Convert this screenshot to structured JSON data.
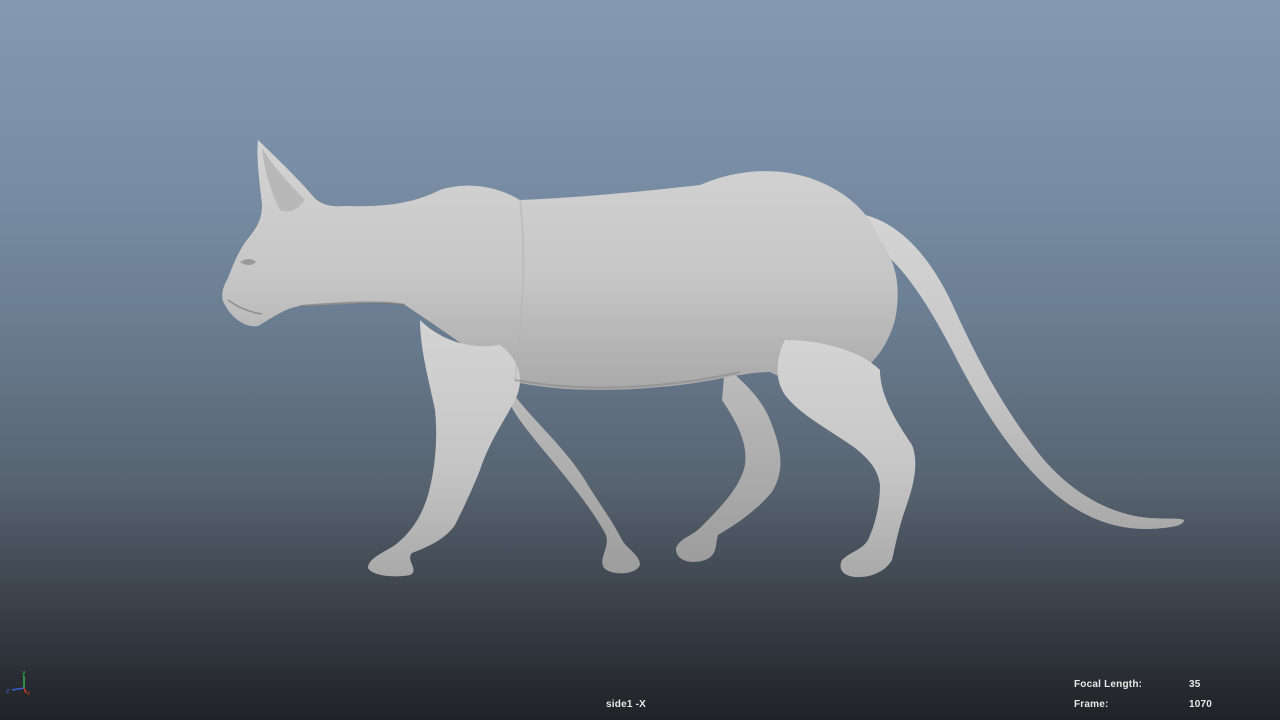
{
  "viewport": {
    "camera_name": "side1 -X",
    "hud": {
      "focal_length_label": "Focal Length:",
      "focal_length_value": "35",
      "frame_label": "Frame:",
      "frame_value": "1070"
    },
    "axis_gizmo": {
      "labels": [
        "y",
        "z",
        "x"
      ],
      "colors": {
        "x": "#d23a2a",
        "y": "#2fb24a",
        "z": "#3a5fd6"
      }
    },
    "background_colors": {
      "top": "#8499b1",
      "bottom": "#1f2226"
    },
    "model": {
      "icon": "sphynx-cat-walking-mesh",
      "shading_color": "#c9c9c9"
    }
  }
}
